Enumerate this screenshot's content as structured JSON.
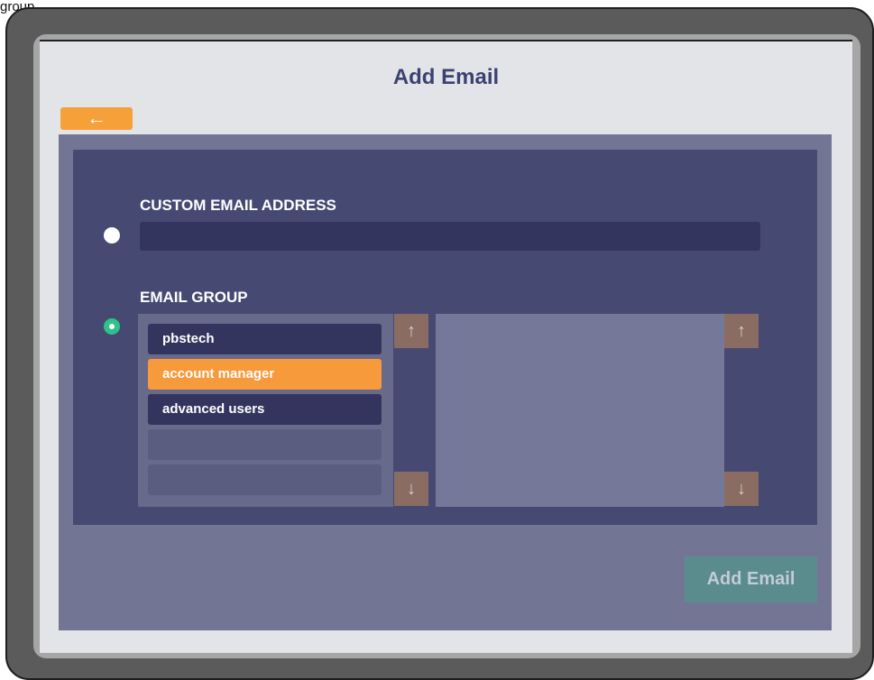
{
  "top_fragment": "group.",
  "page": {
    "title": "Add Email",
    "back_icon": "←"
  },
  "custom_email": {
    "label": "CUSTOM EMAIL ADDRESS",
    "value": "",
    "placeholder": "",
    "selected": false
  },
  "email_group": {
    "label": "EMAIL GROUP",
    "selected": true,
    "items": [
      {
        "label": "pbstech",
        "state": "normal"
      },
      {
        "label": "account manager",
        "state": "selected"
      },
      {
        "label": "advanced users",
        "state": "normal"
      },
      {
        "label": "",
        "state": "empty"
      },
      {
        "label": "",
        "state": "empty"
      }
    ],
    "up_icon": "↑",
    "down_icon": "↓"
  },
  "actions": {
    "add_email_label": "Add Email"
  },
  "colors": {
    "accent_orange": "#f69a3b",
    "panel_bg": "#464a72",
    "radio_selected": "#2ec28a",
    "button_teal": "#5a8c8d"
  }
}
